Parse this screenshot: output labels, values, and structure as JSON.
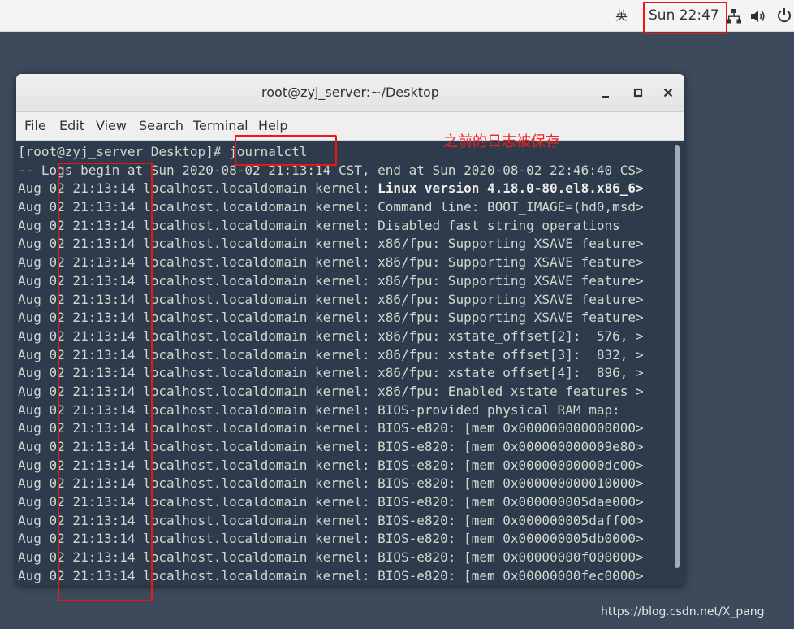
{
  "topbar": {
    "input_method": "英",
    "clock": "Sun 22:47",
    "icons": [
      "network-icon",
      "volume-icon",
      "power-icon"
    ]
  },
  "window": {
    "title": "root@zyj_server:~/Desktop",
    "controls": {
      "minimize": "_",
      "maximize": "▫",
      "close": "×"
    },
    "menu": [
      "File",
      "Edit",
      "View",
      "Search",
      "Terminal",
      "Help"
    ]
  },
  "terminal": {
    "prompt": "[root@zyj_server Desktop]# ",
    "command": "journalctl",
    "lines": [
      "-- Logs begin at Sun 2020-08-02 21:13:14 CST, end at Sun 2020-08-02 22:46:40 CS>",
      "Aug 02 21:13:14 localhost.localdomain kernel: |Linux version 4.18.0-80.el8.x86_6>",
      "Aug 02 21:13:14 localhost.localdomain kernel: Command line: BOOT_IMAGE=(hd0,msd>",
      "Aug 02 21:13:14 localhost.localdomain kernel: Disabled fast string operations",
      "Aug 02 21:13:14 localhost.localdomain kernel: x86/fpu: Supporting XSAVE feature>",
      "Aug 02 21:13:14 localhost.localdomain kernel: x86/fpu: Supporting XSAVE feature>",
      "Aug 02 21:13:14 localhost.localdomain kernel: x86/fpu: Supporting XSAVE feature>",
      "Aug 02 21:13:14 localhost.localdomain kernel: x86/fpu: Supporting XSAVE feature>",
      "Aug 02 21:13:14 localhost.localdomain kernel: x86/fpu: Supporting XSAVE feature>",
      "Aug 02 21:13:14 localhost.localdomain kernel: x86/fpu: xstate_offset[2]:  576, >",
      "Aug 02 21:13:14 localhost.localdomain kernel: x86/fpu: xstate_offset[3]:  832, >",
      "Aug 02 21:13:14 localhost.localdomain kernel: x86/fpu: xstate_offset[4]:  896, >",
      "Aug 02 21:13:14 localhost.localdomain kernel: x86/fpu: Enabled xstate features >",
      "Aug 02 21:13:14 localhost.localdomain kernel: BIOS-provided physical RAM map:",
      "Aug 02 21:13:14 localhost.localdomain kernel: BIOS-e820: [mem 0x000000000000000>",
      "Aug 02 21:13:14 localhost.localdomain kernel: BIOS-e820: [mem 0x000000000009e80>",
      "Aug 02 21:13:14 localhost.localdomain kernel: BIOS-e820: [mem 0x00000000000dc00>",
      "Aug 02 21:13:14 localhost.localdomain kernel: BIOS-e820: [mem 0x000000000010000>",
      "Aug 02 21:13:14 localhost.localdomain kernel: BIOS-e820: [mem 0x000000005dae000>",
      "Aug 02 21:13:14 localhost.localdomain kernel: BIOS-e820: [mem 0x000000005daff00>",
      "Aug 02 21:13:14 localhost.localdomain kernel: BIOS-e820: [mem 0x000000005db0000>",
      "Aug 02 21:13:14 localhost.localdomain kernel: BIOS-e820: [mem 0x00000000f000000>",
      "Aug 02 21:13:14 localhost.localdomain kernel: BIOS-e820: [mem 0x00000000fec0000>"
    ]
  },
  "annotation": {
    "text": "之前的日志被保存",
    "color": "#f01515"
  },
  "watermark": "https://blog.csdn.net/X_pang",
  "colors": {
    "terminal_bg": "#2e3b4c",
    "desktop_bg": "#3d4a5b",
    "annotation_red": "#f01515"
  }
}
